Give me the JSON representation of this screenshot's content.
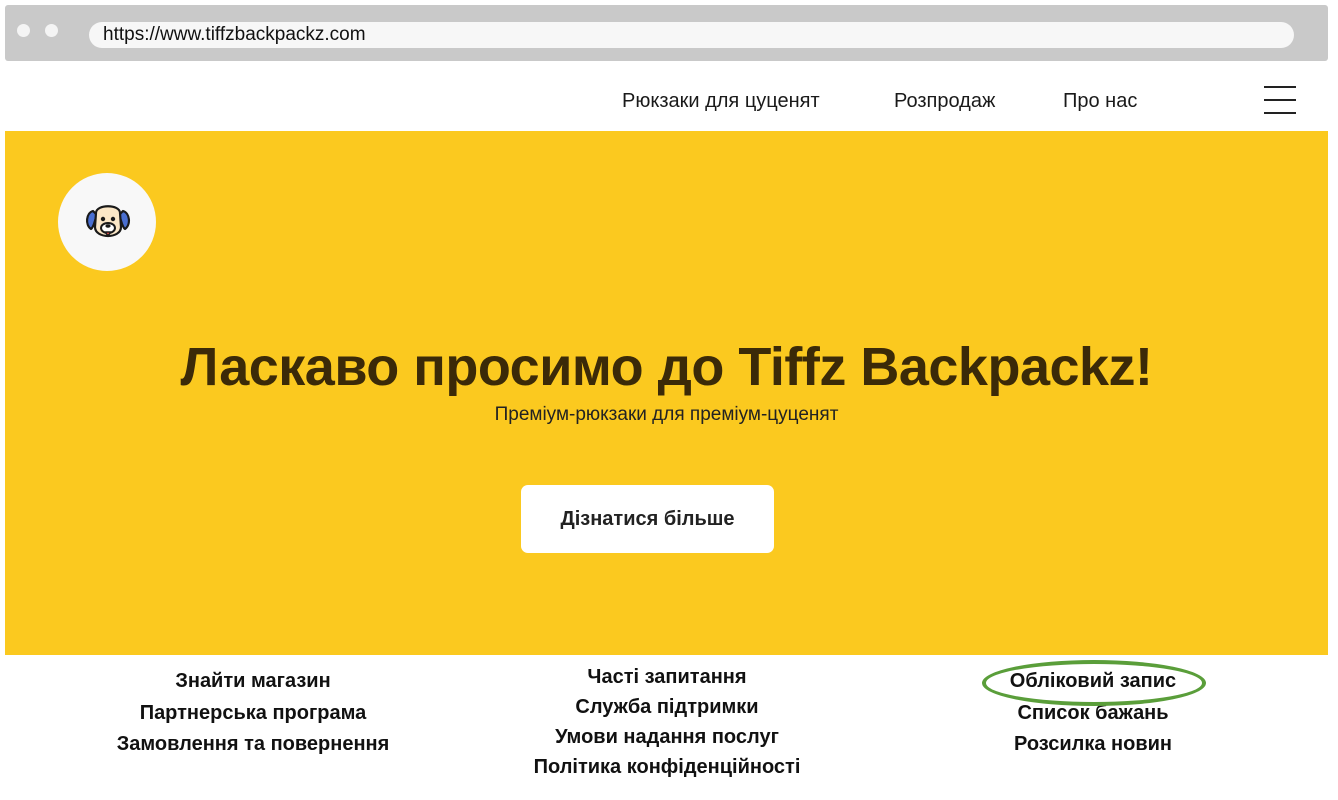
{
  "browser": {
    "url": "https://www.tiffzbackpackz.com"
  },
  "nav": {
    "links": [
      "Рюкзаки для цуценят",
      "Розпродаж",
      "Про нас"
    ],
    "menu_icon": "hamburger-icon"
  },
  "hero": {
    "logo_icon": "dog-face-icon",
    "title": "Ласкаво просимо до Tiffz Backpackz!",
    "subtitle": "Преміум-рюкзаки для преміум-цуценят",
    "cta_label": "Дізнатися більше",
    "background_color": "#fbc91f"
  },
  "footer": {
    "col1": [
      "Знайти магазин",
      "Партнерська програма",
      "Замовлення та повернення"
    ],
    "col2": [
      "Часті запитання",
      "Служба підтримки",
      "Умови надання послуг",
      "Політика конфіденційності"
    ],
    "col3": [
      "Обліковий запис",
      "Список бажань",
      "Розсилка новин"
    ],
    "highlight_color": "#5a9e3a"
  }
}
